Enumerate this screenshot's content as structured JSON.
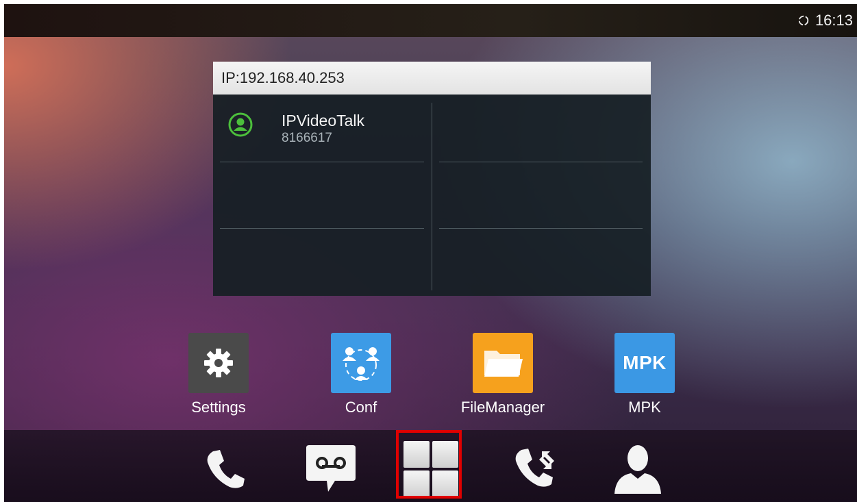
{
  "status_bar": {
    "time": "16:13",
    "icon": "sync-icon"
  },
  "widget": {
    "ip_label": "IP:192.168.40.253",
    "account": {
      "name": "IPVideoTalk",
      "number": "8166617",
      "icon": "account-user-icon",
      "status_color": "#4cbf3c"
    }
  },
  "apps": [
    {
      "label": "Settings",
      "icon": "gear-icon"
    },
    {
      "label": "Conf",
      "icon": "conference-icon"
    },
    {
      "label": "FileManager",
      "icon": "folder-icon"
    },
    {
      "label": "MPK",
      "icon": "mpk-icon",
      "icon_text": "MPK"
    }
  ],
  "dock": [
    {
      "icon": "phone-icon"
    },
    {
      "icon": "voicemail-icon"
    },
    {
      "icon": "apps-grid-icon",
      "selected": true
    },
    {
      "icon": "call-transfer-icon"
    },
    {
      "icon": "contacts-icon"
    }
  ],
  "colors": {
    "highlight": "#e00000",
    "accent": "#3d9be6"
  }
}
